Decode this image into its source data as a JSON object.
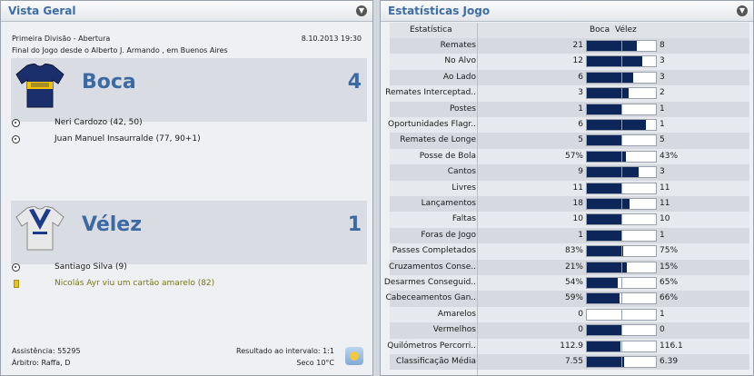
{
  "left_panel": {
    "title": "Vista Geral",
    "competition": "Primeira Divisão - Abertura",
    "datetime": "8.10.2013 19:30",
    "venue": "Final do Jogo desde o Alberto J. Armando , em Buenos Aires",
    "home": {
      "name": "Boca",
      "score": "4",
      "events": [
        {
          "type": "goal",
          "text": "Neri Cardozo (42, 50)"
        },
        {
          "type": "goal",
          "text": "Juan Manuel Insaurralde (77, 90+1)"
        }
      ]
    },
    "away": {
      "name": "Vélez",
      "score": "1",
      "events": [
        {
          "type": "goal",
          "text": "Santiago Silva (9)"
        },
        {
          "type": "yellow-card",
          "text": "Nicolás Ayr viu um cartão amarelo (82)"
        }
      ]
    },
    "attendance": "Assistência: 55295",
    "referee": "Árbitro: Raffa, D",
    "halftime": "Resultado ao intervalo: 1:1",
    "weather": "Seco 10°C",
    "colors": {
      "accent": "#3d6aa3",
      "home_kit": "#1a2f6b",
      "home_stripe": "#f2c200",
      "away_kit": "#e8e8e8",
      "away_v": "#1b3a8a"
    }
  },
  "right_panel": {
    "title": "Estatísticas Jogo",
    "header": {
      "stat": "Estatística",
      "home": "Boca",
      "away": "Vélez"
    },
    "bar_color": "#0d2659",
    "rows": [
      {
        "label": "Remates",
        "home": "21",
        "away": "8",
        "share": 0.72
      },
      {
        "label": "No Alvo",
        "home": "12",
        "away": "3",
        "share": 0.8
      },
      {
        "label": "Ao Lado",
        "home": "6",
        "away": "3",
        "share": 0.67
      },
      {
        "label": "Remates Interceptad..",
        "home": "3",
        "away": "2",
        "share": 0.6
      },
      {
        "label": "Postes",
        "home": "1",
        "away": "1",
        "share": 0.5
      },
      {
        "label": "Oportunidades Flagr..",
        "home": "6",
        "away": "1",
        "share": 0.86
      },
      {
        "label": "Remates de Longe",
        "home": "5",
        "away": "5",
        "share": 0.5
      },
      {
        "label": "Posse de Bola",
        "home": "57%",
        "away": "43%",
        "share": 0.57
      },
      {
        "label": "Cantos",
        "home": "9",
        "away": "3",
        "share": 0.75
      },
      {
        "label": "Livres",
        "home": "11",
        "away": "11",
        "share": 0.5
      },
      {
        "label": "Lançamentos",
        "home": "18",
        "away": "11",
        "share": 0.62
      },
      {
        "label": "Faltas",
        "home": "10",
        "away": "10",
        "share": 0.5
      },
      {
        "label": "Foras de Jogo",
        "home": "1",
        "away": "1",
        "share": 0.5
      },
      {
        "label": "Passes Completados",
        "home": "83%",
        "away": "75%",
        "share": 0.53
      },
      {
        "label": "Cruzamentos Conse..",
        "home": "21%",
        "away": "15%",
        "share": 0.58
      },
      {
        "label": "Desarmes Conseguid..",
        "home": "54%",
        "away": "65%",
        "share": 0.45
      },
      {
        "label": "Cabeceamentos Gan..",
        "home": "59%",
        "away": "66%",
        "share": 0.47
      },
      {
        "label": "Amarelos",
        "home": "0",
        "away": "1",
        "share": 0.0
      },
      {
        "label": "Vermelhos",
        "home": "0",
        "away": "0",
        "share": 0.5
      },
      {
        "label": "Quilómetros Percorri..",
        "home": "112.9",
        "away": "116.1",
        "share": 0.49
      },
      {
        "label": "Classificação Média",
        "home": "7.55",
        "away": "6.39",
        "share": 0.54
      }
    ]
  }
}
